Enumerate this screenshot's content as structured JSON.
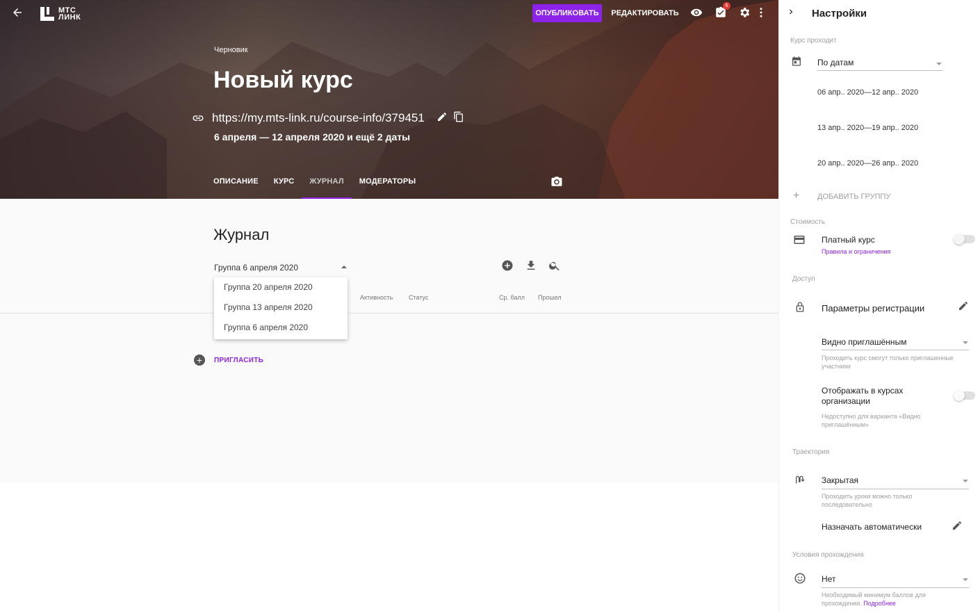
{
  "header": {
    "logo_text_line1": "МТС",
    "logo_text_line2": "ЛИНК",
    "publish_label": "ОПУБЛИКОВАТЬ",
    "edit_label": "РЕДАКТИРОВАТЬ",
    "tasks_badge": "6",
    "accent": "#8d22e8"
  },
  "course": {
    "status": "Черновик",
    "title": "Новый курс",
    "url": "https://my.mts-link.ru/course-info/379451",
    "dates": "6 апреля — 12 апреля 2020 и ещё 2 даты"
  },
  "tabs": [
    {
      "label": "ОПИСАНИЕ"
    },
    {
      "label": "КУРС"
    },
    {
      "label": "ЖУРНАЛ"
    },
    {
      "label": "МОДЕРАТОРЫ"
    }
  ],
  "journal": {
    "title": "Журнал",
    "selected_group": "Группа 6 апреля 2020",
    "columns": [
      "Активность",
      "Статус",
      "Ср. балл",
      "Прошел"
    ],
    "dropdown": [
      "Группа 20 апреля 2020",
      "Группа 13 апреля 2020",
      "Группа 6 апреля 2020"
    ],
    "invite_label": "ПРИГЛАСИТЬ"
  },
  "settings": {
    "title": "Настройки",
    "schedule_section": "Курс проходит",
    "schedule_value": "По датам",
    "date_ranges": [
      "06 апр.. 2020—12 апр.. 2020",
      "13 апр.. 2020—19 апр.. 2020",
      "20 апр.. 2020—26 апр.. 2020"
    ],
    "add_group": "ДОБАВИТЬ ГРУППУ",
    "cost_section": "Стоимость",
    "paid_label": "Платный курс",
    "paid_link": "Правила и ограничения",
    "access_section": "Доступ",
    "registration_label": "Параметры регистрации",
    "visibility_value": "Видно приглашённым",
    "visibility_hint": "Проходить курс смогут только приглашенные участники",
    "show_in_org_label": "Отображать в курсах организации",
    "show_in_org_hint": "Недоступно для варианта «Видно приглашённым»",
    "trajectory_section": "Траектория",
    "trajectory_value": "Закрытая",
    "trajectory_hint": "Проходить уроки можно только последовательно",
    "assign_auto_label": "Назначать автоматически",
    "conditions_section": "Условия прохождения",
    "conditions_value": "Нет",
    "conditions_hint": "Необходимый минимум баллов для прохождения.",
    "conditions_link": "Подробнее"
  }
}
